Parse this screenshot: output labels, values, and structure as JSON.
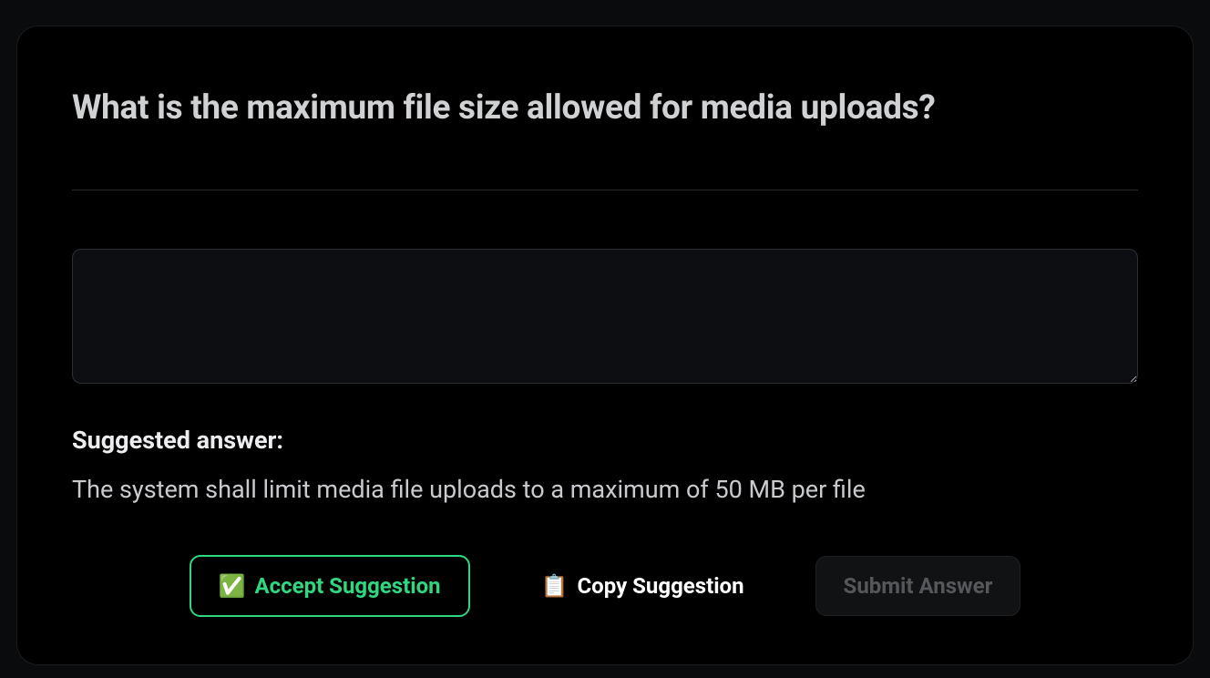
{
  "question": {
    "title": "What is the maximum file size allowed for media uploads?"
  },
  "answer_input": {
    "value": "",
    "placeholder": ""
  },
  "suggestion": {
    "label": "Suggested answer:",
    "text": "The system shall limit media file uploads to a maximum of 50 MB per file"
  },
  "buttons": {
    "accept": {
      "icon": "✅",
      "label": "Accept Suggestion"
    },
    "copy": {
      "icon": "📋",
      "label": "Copy Suggestion"
    },
    "submit": {
      "label": "Submit Answer"
    }
  }
}
